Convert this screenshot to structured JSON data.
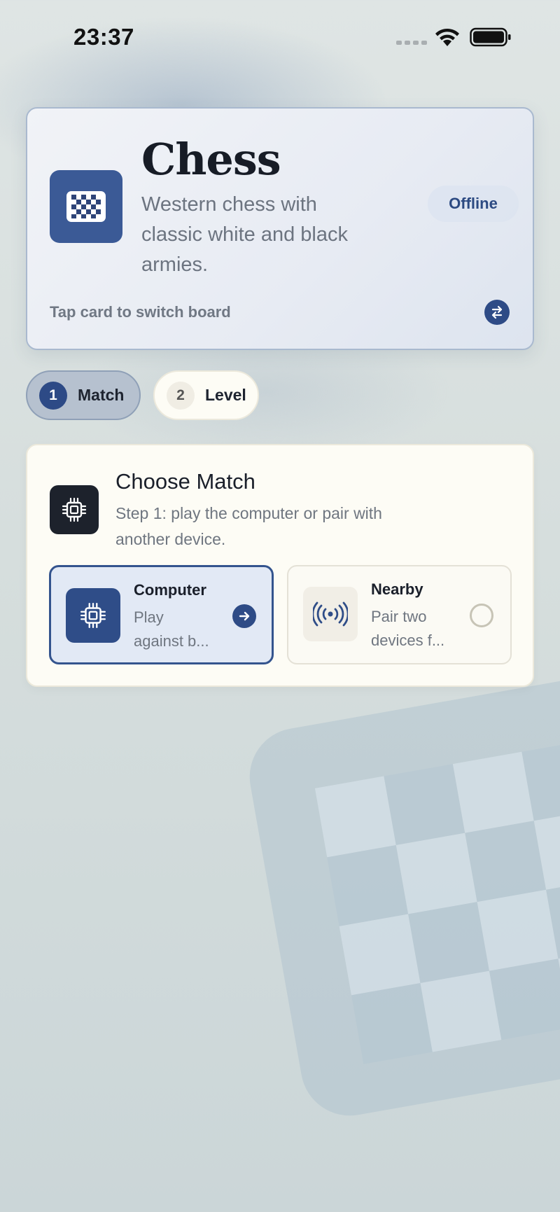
{
  "status_bar": {
    "time": "23:37"
  },
  "header_card": {
    "title": "Chess",
    "description": "Western chess with classic white and black armies.",
    "badge": "Offline",
    "switch_hint": "Tap card to switch board",
    "icon": "chessboard-icon",
    "accent_color": "#3b5a96"
  },
  "steps": [
    {
      "number": "1",
      "label": "Match",
      "active": true
    },
    {
      "number": "2",
      "label": "Level",
      "active": false
    }
  ],
  "choose_match": {
    "title": "Choose Match",
    "description": "Step 1: play the computer or pair with another device.",
    "icon": "cpu-chip-icon",
    "options": [
      {
        "title": "Computer",
        "subtitle": "Play against b...",
        "icon": "cpu-chip-icon",
        "selected": true
      },
      {
        "title": "Nearby",
        "subtitle": "Pair two devices f...",
        "icon": "broadcast-icon",
        "selected": false
      }
    ]
  }
}
